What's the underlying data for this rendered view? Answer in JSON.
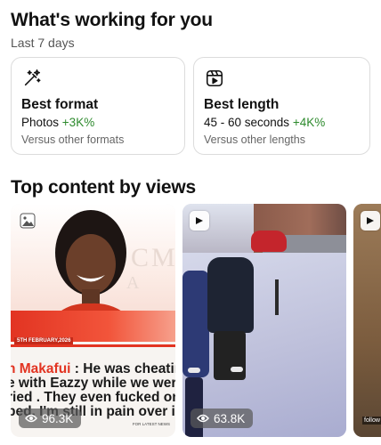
{
  "working": {
    "title": "What's working for you",
    "subtitle": "Last 7 days",
    "cards": [
      {
        "icon": "magic-wand-icon",
        "title": "Best format",
        "value": "Photos",
        "delta": "+3K%",
        "note": "Versus other formats"
      },
      {
        "icon": "reels-icon",
        "title": "Best length",
        "value": "45 - 60 seconds",
        "delta": "+4K%",
        "note": "Versus other lengths"
      }
    ]
  },
  "top_content": {
    "title": "Top content by views",
    "items": [
      {
        "type_icon": "photo-icon",
        "views": "96.3K",
        "date_banner": "5TH FEBRUARY,2026",
        "caption_line1_name": "n Makafui",
        "caption_line1_rest": " : He was cheating",
        "caption_line2": "e with Eazzy while we wer",
        "caption_line3": "ried . They even fucked on",
        "caption_line4": "bed. I'm still in pain over it.",
        "footer": "FOR LATEST NEWS"
      },
      {
        "type_icon": "video-icon",
        "views": "63.8K"
      },
      {
        "type_icon": "video-icon",
        "label": "follow"
      }
    ]
  },
  "colors": {
    "delta_green": "#2d8a2d",
    "accent_red": "#e23422"
  }
}
